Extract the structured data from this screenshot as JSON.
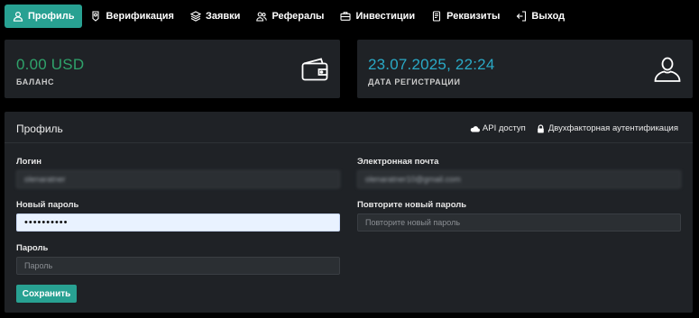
{
  "nav": {
    "items": [
      {
        "label": "Профиль",
        "icon": "user-icon",
        "active": true
      },
      {
        "label": "Верификация",
        "icon": "badge-icon"
      },
      {
        "label": "Заявки",
        "icon": "layers-icon"
      },
      {
        "label": "Рефералы",
        "icon": "users-icon"
      },
      {
        "label": "Инвестиции",
        "icon": "briefcase-icon"
      },
      {
        "label": "Реквизиты",
        "icon": "card-icon"
      },
      {
        "label": "Выход",
        "icon": "logout-icon"
      }
    ]
  },
  "balance": {
    "value": "0.00 USD",
    "label": "БАЛАНС",
    "icon": "wallet-icon",
    "color": "#2fa36b"
  },
  "registration": {
    "value": "23.07.2025, 22:24",
    "label": "ДАТА РЕГИСТРАЦИИ",
    "icon": "user-outline-icon",
    "color": "#2aa9c6"
  },
  "profile": {
    "title": "Профиль",
    "api_link": "API доступ",
    "twofa_link": "Двухфакторная аутентификация",
    "login_label": "Логин",
    "login_value": "olenaratner",
    "email_label": "Электронная почта",
    "email_value": "olenaratner10@gmail.com",
    "new_password_label": "Новый пароль",
    "new_password_value": "••••••••••",
    "repeat_password_label": "Повторите новый пароль",
    "repeat_password_placeholder": "Повторите новый пароль",
    "password_label": "Пароль",
    "password_placeholder": "Пароль",
    "save_label": "Сохранить"
  },
  "colors": {
    "accent": "#28a192",
    "panel": "#1f2226",
    "background": "#000000"
  }
}
